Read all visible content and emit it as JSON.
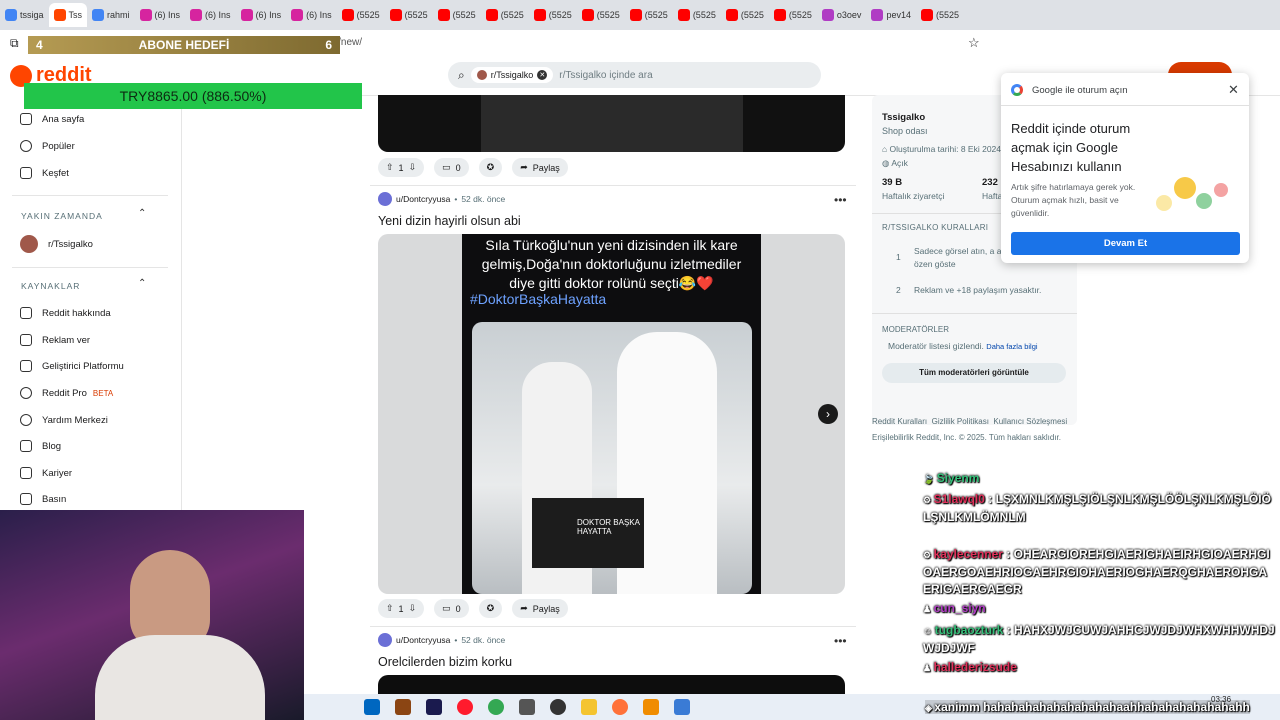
{
  "browser": {
    "tabs": [
      {
        "label": "tssiga",
        "color": "#4285f4"
      },
      {
        "label": "Tss",
        "color": "#ff4500",
        "active": true
      },
      {
        "label": "rahmi",
        "color": "#4285f4"
      },
      {
        "label": "(6) Ins",
        "color": "#d6249f"
      },
      {
        "label": "(6) Ins",
        "color": "#d6249f"
      },
      {
        "label": "(6) Ins",
        "color": "#d6249f"
      },
      {
        "label": "(6) Ins",
        "color": "#d6249f"
      },
      {
        "label": "(5525",
        "color": "#ff0000"
      },
      {
        "label": "(5525",
        "color": "#ff0000"
      },
      {
        "label": "(5525",
        "color": "#ff0000"
      },
      {
        "label": "(5525",
        "color": "#ff0000"
      },
      {
        "label": "(5525",
        "color": "#ff0000"
      },
      {
        "label": "(5525",
        "color": "#ff0000"
      },
      {
        "label": "(5525",
        "color": "#ff0000"
      },
      {
        "label": "(5525",
        "color": "#ff0000"
      },
      {
        "label": "(5525",
        "color": "#ff0000"
      },
      {
        "label": "(5525",
        "color": "#ff0000"
      },
      {
        "label": "o3oev",
        "color": "#b03cc4"
      },
      {
        "label": "pev14",
        "color": "#b03cc4"
      },
      {
        "label": "(5525",
        "color": "#ff0000"
      }
    ],
    "url": "w.reddit.com/r/Tssigalko/new/"
  },
  "overlay": {
    "abone_left": "4",
    "abone_title": "ABONE HEDEFİ",
    "abone_right": "6",
    "money": "TRY8865.00 (886.50%)"
  },
  "reddit": {
    "logo_text": "reddit",
    "search_chip": "r/Tssigalko",
    "search_placeholder": "r/Tssigalko içinde ara"
  },
  "sidebar": {
    "top_items": [
      {
        "label": "Ana sayfa"
      },
      {
        "label": "Popüler"
      },
      {
        "label": "Keşfet"
      }
    ],
    "recent_title": "YAKIN ZAMANDA",
    "recent_item": "r/Tssigalko",
    "resources_title": "KAYNAKLAR",
    "resources": [
      {
        "label": "Reddit hakkında"
      },
      {
        "label": "Reklam ver"
      },
      {
        "label": "Geliştirici Platformu"
      },
      {
        "label": "Reddit Pro",
        "badge": "BETA"
      },
      {
        "label": "Yardım Merkezi"
      },
      {
        "label": "Blog"
      },
      {
        "label": "Kariyer"
      },
      {
        "label": "Basın"
      }
    ]
  },
  "posts": [
    {
      "votes": "1",
      "comments": "0",
      "share": "Paylaş"
    },
    {
      "author": "u/Dontcryyusa",
      "time": "52 dk. önce",
      "title": "Yeni dizin hayirli olsun abi",
      "image_caption": "Sıla Türkoğlu'nun yeni dizisinden ilk kare gelmiş,Doğa'nın doktorluğunu izletmediler diye gitti doktor rolünü seçti😂❤️",
      "image_hashtag": "#DoktorBaşkaHayatta",
      "clapper_text": "DOKTOR BAŞKA HAYATTA",
      "votes": "1",
      "comments": "0",
      "share": "Paylaş"
    },
    {
      "author": "u/Dontcryyusa",
      "time": "52 dk. önce",
      "title": "Orelcilerden bizim korku"
    }
  ],
  "right_sidebar": {
    "name": "Tssigalko",
    "subtitle": "Shop odası",
    "created": "Oluşturulma tarihi: 8 Eki 2024",
    "visibility": "Açık",
    "weekly_visitors_value": "39 B",
    "weekly_visitors_label": "Haftalık ziyaretçi",
    "weekly_contrib_value": "232",
    "weekly_contrib_label": "Haftalık",
    "rules_title": "R/TSSIGALKO KURALLARI",
    "rules": [
      {
        "num": "1",
        "text": "Sadece görsel atın, a atmamaya özen göste"
      },
      {
        "num": "2",
        "text": "Reklam ve +18 paylaşım yasaktır."
      }
    ],
    "mods_title": "MODERATÖRLER",
    "mods_hidden": "Moderatör listesi gizlendi.",
    "mods_more": "Daha fazla bilgi",
    "mods_button": "Tüm moderatörleri görüntüle",
    "footer_links": [
      "Reddit Kuralları",
      "Gizlilik Politikası",
      "Kullanıcı Sözleşmesi"
    ],
    "footer_line2": "Erişilebilirlik  Reddit, Inc. © 2025. Tüm hakları saklıdır."
  },
  "google_popup": {
    "title": "Google ile oturum açın",
    "heading": "Reddit içinde oturum açmak için Google Hesabınızı kullanın",
    "body": "Artık şifre hatırlamaya gerek yok. Oturum açmak hızlı, basit ve güvenlidir.",
    "button": "Devam Et"
  },
  "chat": [
    {
      "user": "Siyenm",
      "text": "",
      "color": "#35c07a"
    },
    {
      "user": "S1lawql0",
      "text": "LŞXMNLKMŞLŞIÖLŞNLKMŞLÖÖLŞNLKMŞLÖIÖLŞNLKMLÖMNLM",
      "color": "#e0305a"
    },
    {
      "user": "kaylecenner",
      "text": "OHEARGIOREHGIAERIGHAEIRHGIOAERHGIOAERGOAEHRIOGAEHRGIOHAERIOGHAERQGHAEROHGAERIGAERGAEGR",
      "color": "#e0305a"
    },
    {
      "user": "cun_siyn",
      "text": "",
      "color": "#b03cc4"
    },
    {
      "user": "tugbaozturk",
      "text": "HAHXJWJCUWJAHHCJWJDJWHXWHHWHDJWJDJWF",
      "color": "#35c07a"
    },
    {
      "user": "hallederizsude",
      "text": "",
      "color": "#e0305a"
    },
    {
      "user": "xanimm",
      "text": "hahahahahahahahahahaahhahahahahahahahh",
      "color": "#ffffff"
    }
  ],
  "taskbar": {
    "time": "03:36"
  }
}
